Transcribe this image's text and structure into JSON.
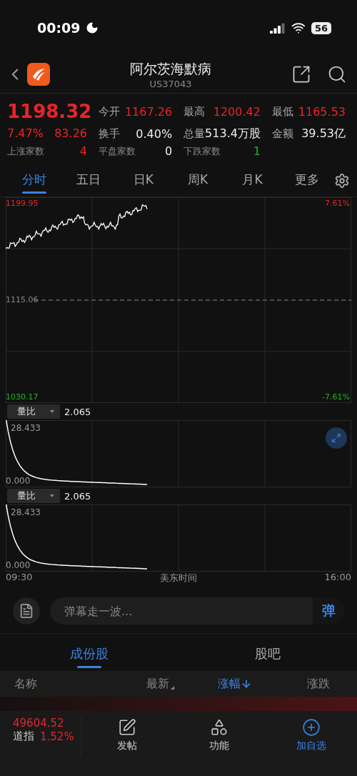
{
  "status_bar": {
    "time": "00:09",
    "battery": "56"
  },
  "header": {
    "title": "阿尔茨海默病",
    "code": "US37043"
  },
  "quote": {
    "price": "1198.32",
    "change_pct": "7.47%",
    "change": "83.26",
    "stats": [
      {
        "label": "今开",
        "value": "1167.26",
        "color": "#e8242a"
      },
      {
        "label": "最高",
        "value": "1200.42",
        "color": "#e8242a"
      },
      {
        "label": "最低",
        "value": "1165.53",
        "color": "#e8242a"
      },
      {
        "label": "换手",
        "value": "0.40%",
        "color": "#eeeeee"
      },
      {
        "label": "总量",
        "value": "513.4万股",
        "color": "#eeeeee"
      },
      {
        "label": "金额",
        "value": "39.53亿",
        "color": "#eeeeee"
      }
    ],
    "breadth": [
      {
        "label": "上涨家数",
        "value": "4",
        "color": "#e8242a"
      },
      {
        "label": "平盘家数",
        "value": "0",
        "color": "#eeeeee"
      },
      {
        "label": "下跌家数",
        "value": "1",
        "color": "#1fb32a"
      }
    ]
  },
  "chart_tabs": [
    {
      "label": "分时",
      "selected": true
    },
    {
      "label": "五日",
      "selected": false
    },
    {
      "label": "日K",
      "selected": false
    },
    {
      "label": "周K",
      "selected": false
    },
    {
      "label": "月K",
      "selected": false
    },
    {
      "label": "更多",
      "selected": false
    }
  ],
  "price_chart": {
    "high": "1199.95",
    "mid": "1115.06",
    "low": "1030.17",
    "high_pct": "7.61%",
    "low_pct": "-7.61%"
  },
  "indicators": [
    {
      "name": "量比",
      "value": "2.065",
      "max": "28.433",
      "min": "0.000",
      "expand_button": true
    },
    {
      "name": "量比",
      "value": "2.065",
      "max": "28.433",
      "min": "0.000",
      "expand_button": false
    }
  ],
  "time_axis": {
    "start": "09:30",
    "label": "美东时间",
    "end": "16:00"
  },
  "danmaku": {
    "placeholder": "弹幕走一波...",
    "send": "弹"
  },
  "section_tabs": [
    {
      "label": "成份股",
      "selected": true
    },
    {
      "label": "股吧",
      "selected": false
    }
  ],
  "table": {
    "columns": [
      {
        "label": "名称",
        "sorted": false,
        "sort_hint": false
      },
      {
        "label": "最新",
        "sorted": false,
        "sort_hint": true
      },
      {
        "label": "涨幅",
        "sorted": true,
        "sort_hint": false
      },
      {
        "label": "涨跌",
        "sorted": false,
        "sort_hint": false
      }
    ]
  },
  "bottom_bar": {
    "index_value": "49604.52",
    "index_name": "道指",
    "index_pct": "1.52%",
    "actions": [
      {
        "label": "发帖",
        "kind": "post",
        "selected": false
      },
      {
        "label": "功能",
        "kind": "apps",
        "selected": false
      },
      {
        "label": "加自选",
        "kind": "add",
        "selected": true
      }
    ]
  }
}
